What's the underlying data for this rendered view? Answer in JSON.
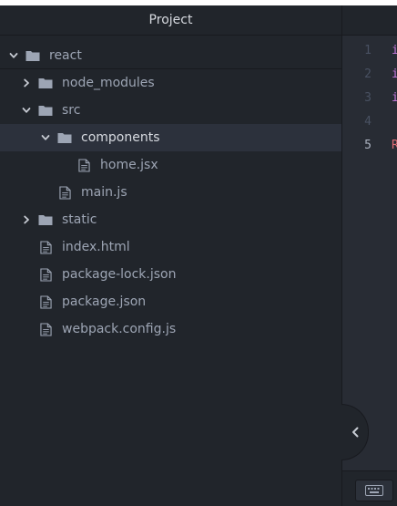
{
  "panel": {
    "title": "Project"
  },
  "tree": [
    {
      "label": "react",
      "type": "folder",
      "depth": 0,
      "expanded": true,
      "selected": false
    },
    {
      "label": "node_modules",
      "type": "folder",
      "depth": 1,
      "expanded": false,
      "selected": false
    },
    {
      "label": "src",
      "type": "folder",
      "depth": 1,
      "expanded": true,
      "selected": false
    },
    {
      "label": "components",
      "type": "folder",
      "depth": 2,
      "expanded": true,
      "selected": true
    },
    {
      "label": "home.jsx",
      "type": "file",
      "depth": 3,
      "selected": false
    },
    {
      "label": "main.js",
      "type": "file",
      "depth": 2,
      "selected": false
    },
    {
      "label": "static",
      "type": "folder",
      "depth": 1,
      "expanded": false,
      "selected": false
    },
    {
      "label": "index.html",
      "type": "file",
      "depth": 1,
      "selected": false
    },
    {
      "label": "package-lock.json",
      "type": "file",
      "depth": 1,
      "selected": false
    },
    {
      "label": "package.json",
      "type": "file",
      "depth": 1,
      "selected": false
    },
    {
      "label": "webpack.config.js",
      "type": "file",
      "depth": 1,
      "selected": false
    }
  ],
  "editor": {
    "line_numbers": [
      "1",
      "2",
      "3",
      "4",
      "5"
    ],
    "active_line": "5",
    "code_first_chars": [
      "i",
      "i",
      "i",
      "",
      "R"
    ]
  },
  "colors": {
    "keyword": "#c678dd",
    "identifier": "#e06c75",
    "icon": "#9da5b4"
  },
  "icons": {
    "folder": "folder-icon",
    "file": "file-icon",
    "expanded": "chevron-down-icon",
    "collapsed": "chevron-right-icon",
    "collapse_panel": "chevron-left-icon",
    "keyboard": "keyboard-icon"
  }
}
